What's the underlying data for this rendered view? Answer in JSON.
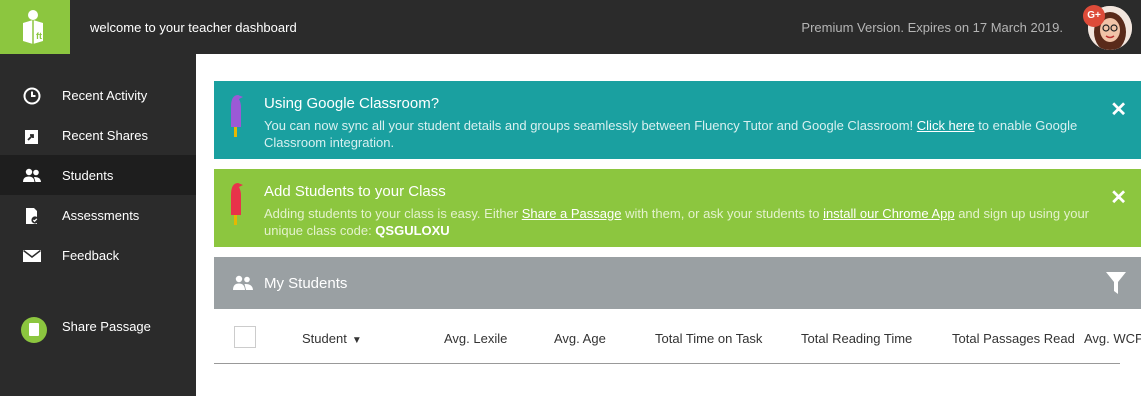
{
  "header": {
    "welcome_text": "welcome to your teacher dashboard",
    "premium_text": "Premium Version. Expires on 17 March 2019.",
    "gplus_badge": "G+"
  },
  "sidebar": {
    "items": [
      {
        "label": "Recent Activity",
        "icon": "clock-icon"
      },
      {
        "label": "Recent Shares",
        "icon": "share-icon"
      },
      {
        "label": "Students",
        "icon": "users-icon",
        "active": true
      },
      {
        "label": "Assessments",
        "icon": "assessment-icon"
      },
      {
        "label": "Feedback",
        "icon": "envelope-icon"
      }
    ],
    "share_passage": "Share Passage"
  },
  "alerts": {
    "google": {
      "title": "Using Google Classroom?",
      "text_before": "You can now sync all your student details and groups seamlessly between Fluency Tutor and Google Classroom! ",
      "link": "Click here",
      "text_after": " to enable Google Classroom integration.",
      "close": "✕"
    },
    "students": {
      "title": "Add Students to your Class",
      "text_1": "Adding students to your class is easy. Either ",
      "link_1": "Share a Passage",
      "text_2": " with them, or ask your students to ",
      "link_2": "install our Chrome App",
      "text_3": " and sign up using your unique class code: ",
      "class_code": "QSGULOXU",
      "close": "✕"
    }
  },
  "students_panel": {
    "title": "My Students",
    "columns": [
      "Student",
      "Avg. Lexile",
      "Avg. Age",
      "Total Time on Task",
      "Total Reading Time",
      "Total Passages Read",
      "Avg. WCPM"
    ]
  },
  "colors": {
    "brand_green": "#8cc63f",
    "teal": "#1aa0a0",
    "dark": "#2b2b2b",
    "panel_gray": "#9aa0a3"
  }
}
